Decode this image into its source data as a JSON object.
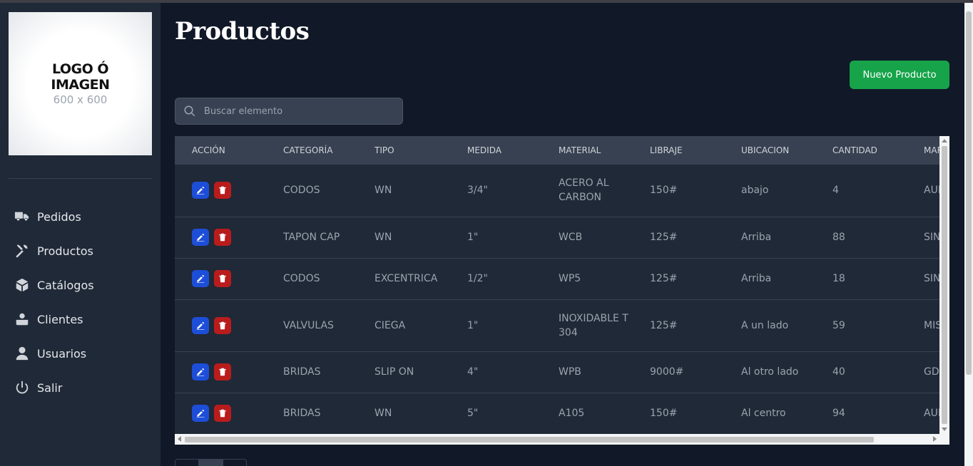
{
  "logo": {
    "line1": "LOGO Ó",
    "line2": "IMAGEN",
    "line3": "600 x 600"
  },
  "nav": [
    {
      "label": "Pedidos",
      "icon": "truck-icon"
    },
    {
      "label": "Productos",
      "icon": "tools-icon"
    },
    {
      "label": "Catálogos",
      "icon": "cube-icon"
    },
    {
      "label": "Clientes",
      "icon": "users-group-icon"
    },
    {
      "label": "Usuarios",
      "icon": "user-icon"
    },
    {
      "label": "Salir",
      "icon": "power-icon"
    }
  ],
  "page": {
    "title": "Productos",
    "new_button": "Nuevo Producto"
  },
  "search": {
    "placeholder": "Buscar elemento"
  },
  "table": {
    "headers": [
      "ACCIÓN",
      "CATEGORÍA",
      "TIPO",
      "MEDIDA",
      "MATERIAL",
      "LIBRAJE",
      "UBICACION",
      "CANTIDAD",
      "MARCA"
    ],
    "rows": [
      [
        "CODOS",
        "WN",
        "3/4\"",
        "ACERO AL CARBON",
        "150#",
        "abajo",
        "4",
        "AUI"
      ],
      [
        "TAPON CAP",
        "WN",
        "1\"",
        "WCB",
        "125#",
        "Arriba",
        "88",
        "SIN"
      ],
      [
        "CODOS",
        "EXCENTRICA",
        "1/2\"",
        "WP5",
        "125#",
        "Arriba",
        "18",
        "SIN"
      ],
      [
        "VALVULAS",
        "CIEGA",
        "1\"",
        "INOXIDABLE T 304",
        "125#",
        "A un lado",
        "59",
        "MIS"
      ],
      [
        "BRIDAS",
        "SLIP ON",
        "4\"",
        "WPB",
        "9000#",
        "Al otro lado",
        "40",
        "GD"
      ],
      [
        "BRIDAS",
        "WN",
        "5\"",
        "A105",
        "150#",
        "Al centro",
        "94",
        "AUI"
      ]
    ]
  },
  "colors": {
    "primary_button": "#16a34a",
    "edit": "#1d4ed8",
    "delete": "#b91c1c"
  }
}
